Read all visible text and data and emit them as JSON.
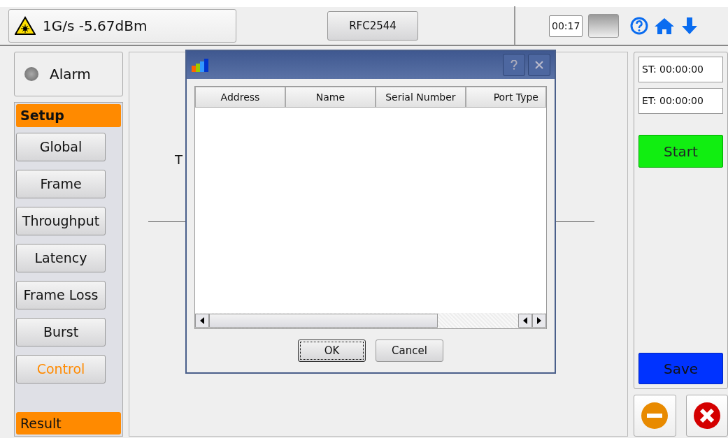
{
  "top_bar": {
    "signal": "1G/s -5.67dBm",
    "test_name": "RFC2544",
    "timer": "00:17"
  },
  "sidebar": {
    "alarm": {
      "label": "Alarm",
      "on": false
    },
    "sections": [
      {
        "label": "Setup",
        "items": [
          {
            "label": "Global",
            "selected": false
          },
          {
            "label": "Frame",
            "selected": false
          },
          {
            "label": "Throughput",
            "selected": false
          },
          {
            "label": "Latency",
            "selected": false
          },
          {
            "label": "Frame Loss",
            "selected": false
          },
          {
            "label": "Burst",
            "selected": false
          },
          {
            "label": "Control",
            "selected": true
          }
        ]
      },
      {
        "label": "Result"
      }
    ]
  },
  "main_panel": {
    "partial_label": "T"
  },
  "dialog": {
    "columns": [
      "Address",
      "Name",
      "Serial Number",
      "Port Type"
    ],
    "buttons": [
      {
        "label": "OK",
        "default": true
      },
      {
        "label": "Cancel",
        "default": false
      }
    ]
  },
  "right_panel": {
    "start_time": "ST:  00:00:00",
    "end_time": "ET:  00:00:00",
    "start": "Start",
    "save": "Save"
  }
}
